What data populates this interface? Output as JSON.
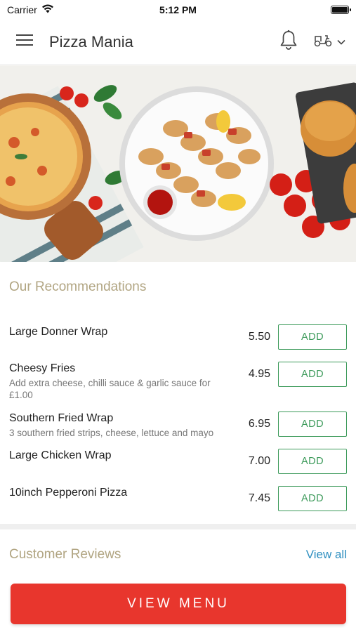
{
  "status_bar": {
    "carrier": "Carrier",
    "time": "5:12 PM"
  },
  "header": {
    "title": "Pizza Mania",
    "icons": {
      "menu": "hamburger-icon",
      "notifications": "bell-icon",
      "delivery": "scooter-icon",
      "dropdown": "chevron-down-icon"
    }
  },
  "hero": {
    "image": "food-banner-pizza-kebabs-burgers"
  },
  "recommendations": {
    "title": "Our Recommendations",
    "add_label": "ADD",
    "items": [
      {
        "name": "Large Donner Wrap",
        "description": "",
        "price": "5.50"
      },
      {
        "name": "Cheesy Fries",
        "description": "Add extra cheese, chilli sauce & garlic sauce for £1.00",
        "price": "4.95"
      },
      {
        "name": "Southern Fried Wrap",
        "description": "3 southern fried strips, cheese, lettuce and mayo",
        "price": "6.95"
      },
      {
        "name": "Large Chicken Wrap",
        "description": "",
        "price": "7.00"
      },
      {
        "name": "10inch Pepperoni Pizza",
        "description": "",
        "price": "7.45"
      }
    ]
  },
  "reviews": {
    "title": "Customer Reviews",
    "view_all": "View all"
  },
  "footer": {
    "view_menu": "VIEW MENU"
  },
  "colors": {
    "accent_red": "#e8362d",
    "add_green": "#3c9a5a",
    "section_gold": "#b1a582",
    "link_blue": "#2e8fc0"
  }
}
